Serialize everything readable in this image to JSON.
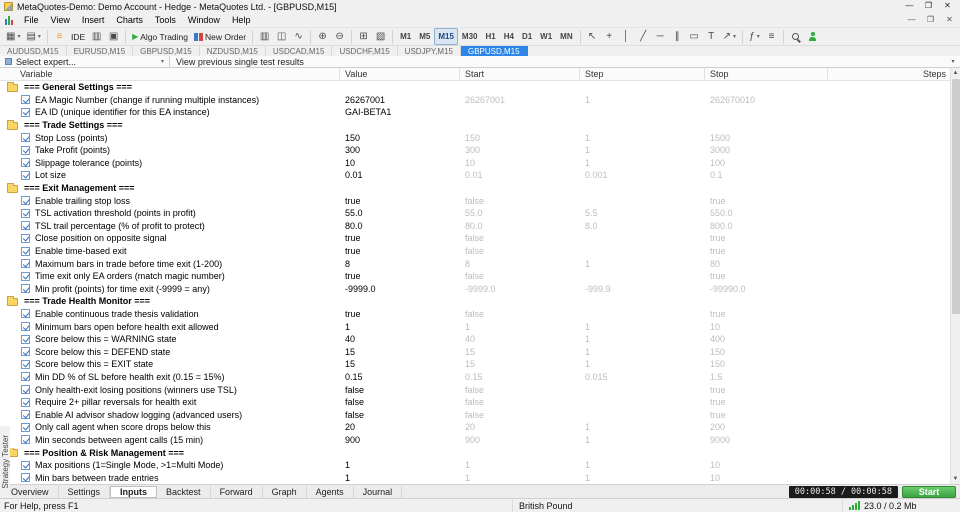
{
  "window": {
    "title": "MetaQuotes-Demo: Demo Account - Hedge - MetaQuotes Ltd. - [GBPUSD,M15]"
  },
  "menu": {
    "items": [
      "File",
      "View",
      "Insert",
      "Charts",
      "Tools",
      "Window",
      "Help"
    ]
  },
  "toolbar": {
    "sections": [
      [
        {
          "name": "new-chart-button",
          "glyph": "▦",
          "caret": true
        },
        {
          "name": "profiles-button",
          "glyph": "▤",
          "caret": true
        }
      ],
      [
        {
          "name": "mql5-community-button",
          "glyph": "≡",
          "color": "#f0a030"
        },
        {
          "name": "metaeditor-ide-button",
          "text": "IDE"
        },
        {
          "name": "open-data-folder-button",
          "glyph": "▥"
        },
        {
          "name": "layouts-button",
          "glyph": "▣"
        }
      ],
      [
        {
          "name": "algo-trading-button",
          "icon": "play",
          "text": "Algo Trading"
        },
        {
          "name": "new-order-button",
          "icon": "order",
          "text": "New Order"
        }
      ],
      [
        {
          "name": "bar-chart-button",
          "glyph": "▥"
        },
        {
          "name": "candlestick-chart-button",
          "glyph": "◫"
        },
        {
          "name": "line-chart-button",
          "glyph": "∿"
        }
      ],
      [
        {
          "name": "zoom-in-button",
          "glyph": "⊕"
        },
        {
          "name": "zoom-out-button",
          "glyph": "⊖"
        }
      ],
      [
        {
          "name": "tile-windows-button",
          "glyph": "⊞"
        },
        {
          "name": "cascade-windows-button",
          "glyph": "▧"
        }
      ],
      [
        {
          "tf": true
        }
      ],
      [
        {
          "name": "cursor-tool-button",
          "glyph": "↖"
        },
        {
          "name": "crosshair-tool-button",
          "glyph": "+"
        },
        {
          "name": "vertical-line-tool-button",
          "glyph": "│"
        },
        {
          "name": "trendline-tool-button",
          "glyph": "╱"
        },
        {
          "name": "horizontal-line-tool-button",
          "glyph": "─"
        },
        {
          "name": "channel-tool-button",
          "glyph": "∥"
        },
        {
          "name": "shapes-tool-button",
          "glyph": "▭"
        },
        {
          "name": "text-tool-button",
          "glyph": "T"
        },
        {
          "name": "arrows-tool-button",
          "glyph": "↗",
          "caret": true
        }
      ],
      [
        {
          "name": "indicators-button",
          "glyph": "ƒ",
          "caret": true
        },
        {
          "name": "objects-list-button",
          "glyph": "≡"
        }
      ],
      [
        {
          "name": "search-button",
          "icon": "search"
        },
        {
          "name": "community-account-button",
          "icon": "person"
        }
      ]
    ],
    "timeframes": [
      "M1",
      "M5",
      "M15",
      "M30",
      "H1",
      "H4",
      "D1",
      "W1",
      "MN"
    ],
    "active_timeframe": "M15"
  },
  "chart_tabs": {
    "tabs": [
      "AUDUSD,M15",
      "EURUSD,M15",
      "GBPUSD,M15",
      "NZDUSD,M15",
      "USDCAD,M15",
      "USDCHF,M15",
      "USDJPY,M15",
      "GBPUSD,M15"
    ],
    "active_index": 7
  },
  "expert_bar": {
    "select_label": "Select expert...",
    "results_label": "View previous single test results"
  },
  "inputs_table": {
    "columns": [
      "Variable",
      "Value",
      "Start",
      "Step",
      "Stop",
      "Steps"
    ],
    "rows": [
      {
        "type": "group",
        "label": "=== General Settings ==="
      },
      {
        "type": "param",
        "label": "EA Magic Number (change if running multiple instances)",
        "value": "26267001",
        "start": "26267001",
        "step": "1",
        "stop": "262670010"
      },
      {
        "type": "param",
        "label": "EA ID (unique identifier for this EA instance)",
        "value": "GAI-BETA1",
        "start": "",
        "step": "",
        "stop": ""
      },
      {
        "type": "group",
        "label": "=== Trade Settings ==="
      },
      {
        "type": "param",
        "label": "Stop Loss (points)",
        "value": "150",
        "start": "150",
        "step": "1",
        "stop": "1500"
      },
      {
        "type": "param",
        "label": "Take Profit (points)",
        "value": "300",
        "start": "300",
        "step": "1",
        "stop": "3000"
      },
      {
        "type": "param",
        "label": "Slippage tolerance (points)",
        "value": "10",
        "start": "10",
        "step": "1",
        "stop": "100"
      },
      {
        "type": "param",
        "label": "Lot size",
        "value": "0.01",
        "start": "0.01",
        "step": "0.001",
        "stop": "0.1"
      },
      {
        "type": "group",
        "label": "=== Exit Management ==="
      },
      {
        "type": "param",
        "label": "Enable trailing stop loss",
        "value": "true",
        "start": "false",
        "step": "",
        "stop": "true"
      },
      {
        "type": "param",
        "label": "TSL activation threshold (points in profit)",
        "value": "55.0",
        "start": "55.0",
        "step": "5.5",
        "stop": "550.0"
      },
      {
        "type": "param",
        "label": "TSL trail percentage (% of profit to protect)",
        "value": "80.0",
        "start": "80.0",
        "step": "8.0",
        "stop": "800.0"
      },
      {
        "type": "param",
        "label": "Close position on opposite signal",
        "value": "true",
        "start": "false",
        "step": "",
        "stop": "true"
      },
      {
        "type": "param",
        "label": "Enable time-based exit",
        "value": "true",
        "start": "false",
        "step": "",
        "stop": "true"
      },
      {
        "type": "param",
        "label": "Maximum bars in trade before time exit (1-200)",
        "value": "8",
        "start": "8",
        "step": "1",
        "stop": "80"
      },
      {
        "type": "param",
        "label": "Time exit only EA orders (match magic number)",
        "value": "true",
        "start": "false",
        "step": "",
        "stop": "true"
      },
      {
        "type": "param",
        "label": "Min profit (points) for time exit (-9999 = any)",
        "value": "-9999.0",
        "start": "-9999.0",
        "step": "-999.9",
        "stop": "-99990.0"
      },
      {
        "type": "group",
        "label": "=== Trade Health Monitor ==="
      },
      {
        "type": "param",
        "label": "Enable continuous trade thesis validation",
        "value": "true",
        "start": "false",
        "step": "",
        "stop": "true"
      },
      {
        "type": "param",
        "label": "Minimum bars open before health exit allowed",
        "value": "1",
        "start": "1",
        "step": "1",
        "stop": "10"
      },
      {
        "type": "param",
        "label": "Score below this = WARNING state",
        "value": "40",
        "start": "40",
        "step": "1",
        "stop": "400"
      },
      {
        "type": "param",
        "label": "Score below this = DEFEND state",
        "value": "15",
        "start": "15",
        "step": "1",
        "stop": "150"
      },
      {
        "type": "param",
        "label": "Score below this = EXIT state",
        "value": "15",
        "start": "15",
        "step": "1",
        "stop": "150"
      },
      {
        "type": "param",
        "label": "Min DD % of SL before health exit (0.15 = 15%)",
        "value": "0.15",
        "start": "0.15",
        "step": "0.015",
        "stop": "1.5"
      },
      {
        "type": "param",
        "label": "Only health-exit losing positions (winners use TSL)",
        "value": "false",
        "start": "false",
        "step": "",
        "stop": "true"
      },
      {
        "type": "param",
        "label": "Require 2+ pillar reversals for health exit",
        "value": "false",
        "start": "false",
        "step": "",
        "stop": "true"
      },
      {
        "type": "param",
        "label": "Enable AI advisor shadow logging (advanced users)",
        "value": "false",
        "start": "false",
        "step": "",
        "stop": "true"
      },
      {
        "type": "param",
        "label": "Only call agent when score drops below this",
        "value": "20",
        "start": "20",
        "step": "1",
        "stop": "200"
      },
      {
        "type": "param",
        "label": "Min seconds between agent calls (15 min)",
        "value": "900",
        "start": "900",
        "step": "1",
        "stop": "9000"
      },
      {
        "type": "group",
        "label": "=== Position & Risk Management ==="
      },
      {
        "type": "param",
        "label": "Max positions (1=Single Mode, >1=Multi Mode)",
        "value": "1",
        "start": "1",
        "step": "1",
        "stop": "10"
      },
      {
        "type": "param",
        "label": "Min bars between trade entries",
        "value": "1",
        "start": "1",
        "step": "1",
        "stop": "10"
      }
    ]
  },
  "tester_panel": {
    "side_label": "Strategy Tester",
    "tabs": [
      "Overview",
      "Settings",
      "Inputs",
      "Backtest",
      "Forward",
      "Graph",
      "Agents",
      "Journal"
    ],
    "active_tab": "Inputs",
    "time": "00:00:58 / 00:00:58",
    "start_label": "Start"
  },
  "status_bar": {
    "help": "For Help, press F1",
    "symbol_desc": "British Pound",
    "traffic": "23.0 / 0.2 Mb"
  },
  "colors": {
    "accent_blue": "#2e86e8",
    "folder_yellow": "#fbd564",
    "start_green": "#3da343",
    "muted_text": "#bdbdbd"
  }
}
